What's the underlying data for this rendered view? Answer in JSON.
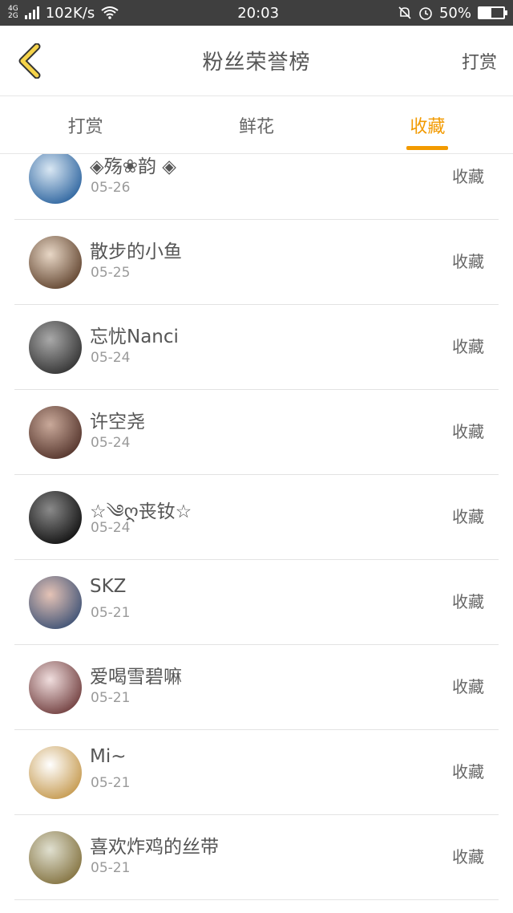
{
  "status_bar": {
    "network_top": "4G",
    "network_bottom": "2G",
    "speed": "102K/s",
    "time": "20:03",
    "battery": "50%",
    "battery_level": 0.5
  },
  "header": {
    "title": "粉丝荣誉榜",
    "right_label": "打赏"
  },
  "tabs": [
    {
      "label": "打赏",
      "active": false
    },
    {
      "label": "鲜花",
      "active": false
    },
    {
      "label": "收藏",
      "active": true
    }
  ],
  "list": [
    {
      "name": "◈殇❀韵 ◈",
      "date": "05-26",
      "action": "收藏",
      "color1": "#3a6ea5",
      "color2": "#d9e7f3"
    },
    {
      "name": "散步的小鱼",
      "date": "05-25",
      "action": "收藏",
      "color1": "#6b4f3a",
      "color2": "#e8d7c6"
    },
    {
      "name": "忘忧Nanci",
      "date": "05-24",
      "action": "收藏",
      "color1": "#3b3b3b",
      "color2": "#a9a9a9"
    },
    {
      "name": "许空尧",
      "date": "05-24",
      "action": "收藏",
      "color1": "#5c3c33",
      "color2": "#c9a99a"
    },
    {
      "name": "☆༄ღ丧钕☆",
      "date": "05-24",
      "action": "收藏",
      "color1": "#1a1a1a",
      "color2": "#8a8a8a"
    },
    {
      "name": "SKZ",
      "date": "05-21",
      "action": "收藏",
      "color1": "#4a5a7a",
      "color2": "#e5c3b6"
    },
    {
      "name": "爱喝雪碧嘛",
      "date": "05-21",
      "action": "收藏",
      "color1": "#7a4a4a",
      "color2": "#f0dede"
    },
    {
      "name": "Mi~",
      "date": "05-21",
      "action": "收藏",
      "color1": "#c9a05a",
      "color2": "#ffffff"
    },
    {
      "name": "喜欢炸鸡的丝带",
      "date": "05-21",
      "action": "收藏",
      "color1": "#8a7a4a",
      "color2": "#e0e0d0"
    }
  ],
  "colors": {
    "accent": "#f29a00",
    "status_bar_bg": "#3f3f3f",
    "back_icon_fill": "#f5d34a"
  }
}
